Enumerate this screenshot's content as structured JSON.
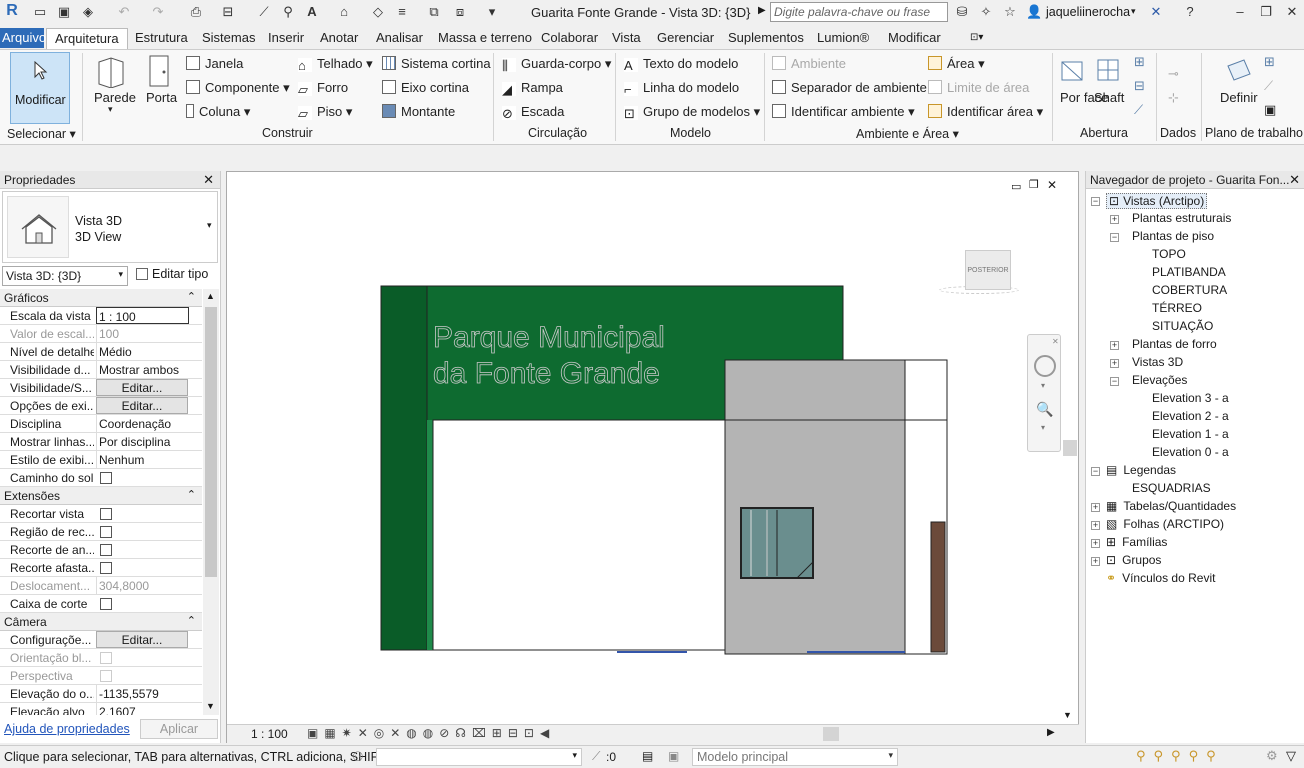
{
  "titlebar": {
    "title": "Guarita Fonte Grande - Vista 3D: {3D}",
    "search_placeholder": "Digite palavra-chave ou frase",
    "user": "jaqueliinerocha"
  },
  "menu": {
    "file": "Arquivo",
    "tabs": [
      "Arquitetura",
      "Estrutura",
      "Sistemas",
      "Inserir",
      "Anotar",
      "Analisar",
      "Massa e terreno",
      "Colaborar",
      "Vista",
      "Gerenciar",
      "Suplementos",
      "Lumion®",
      "Modificar"
    ]
  },
  "ribbon": {
    "select": {
      "modify": "Modificar",
      "panel": "Selecionar"
    },
    "construir": {
      "wall": "Parede",
      "door": "Porta",
      "window": "Janela",
      "component": "Componente",
      "column": "Coluna",
      "roof": "Telhado",
      "ceiling": "Forro",
      "floor": "Piso",
      "curtain_system": "Sistema cortina",
      "curtain_grid": "Eixo cortina",
      "mullion": "Montante",
      "panel": "Construir"
    },
    "circulacao": {
      "railing": "Guarda-corpo",
      "ramp": "Rampa",
      "stair": "Escada",
      "panel": "Circulação"
    },
    "modelo": {
      "model_text": "Texto do modelo",
      "model_line": "Linha do modelo",
      "model_group": "Grupo de modelos",
      "panel": "Modelo"
    },
    "ambiente": {
      "room": "Ambiente",
      "room_sep": "Separador de ambiente",
      "tag_room": "Identificar ambiente",
      "area": "Área",
      "area_boundary": "Limite de área",
      "tag_area": "Identificar área",
      "panel": "Ambiente e Área"
    },
    "abertura": {
      "by_face": "Por face",
      "shaft": "Shaft",
      "panel": "Abertura"
    },
    "dados": {
      "panel": "Dados"
    },
    "plano": {
      "set": "Definir",
      "panel": "Plano de trabalho"
    }
  },
  "properties": {
    "title": "Propriedades",
    "type_name": "Vista 3D",
    "type_sub": "3D View",
    "selector": "Vista 3D: {3D}",
    "edit_type": "Editar tipo",
    "groups": {
      "graphics": "Gráficos",
      "extents": "Extensões",
      "camera": "Câmera"
    },
    "rows": [
      {
        "k": "Escala da vista",
        "v": "1 : 100"
      },
      {
        "k": "Valor de escal...",
        "v": "100"
      },
      {
        "k": "Nível de detalhe",
        "v": "Médio"
      },
      {
        "k": "Visibilidade d...",
        "v": "Mostrar ambos"
      },
      {
        "k": "Visibilidade/S...",
        "v": "Editar..."
      },
      {
        "k": "Opções de exi...",
        "v": "Editar..."
      },
      {
        "k": "Disciplina",
        "v": "Coordenação"
      },
      {
        "k": "Mostrar linhas...",
        "v": "Por disciplina"
      },
      {
        "k": "Estilo de exibi...",
        "v": "Nenhum"
      },
      {
        "k": "Caminho do sol",
        "v": ""
      },
      {
        "k": "Recortar vista",
        "v": ""
      },
      {
        "k": "Região de rec...",
        "v": ""
      },
      {
        "k": "Recorte de an...",
        "v": ""
      },
      {
        "k": "Recorte afasta...",
        "v": ""
      },
      {
        "k": "Deslocament...",
        "v": "304,8000"
      },
      {
        "k": "Caixa de corte",
        "v": ""
      },
      {
        "k": "Configuraçõe...",
        "v": "Editar..."
      },
      {
        "k": "Orientação bl...",
        "v": ""
      },
      {
        "k": "Perspectiva",
        "v": ""
      },
      {
        "k": "Elevação do o...",
        "v": "-1135,5579"
      },
      {
        "k": "Elevação alvo",
        "v": "2,1607"
      }
    ],
    "help_link": "Ajuda de propriedades",
    "apply": "Aplicar"
  },
  "viewport": {
    "sign_line1": "Parque Municipal",
    "sign_line2": "da Fonte Grande",
    "viewcube": "POSTERIOR",
    "scale": "1 : 100"
  },
  "navigator": {
    "title": "Navegador de projeto - Guarita Fon...",
    "items": [
      {
        "label": "Vistas (Arctipo)"
      },
      {
        "label": "Plantas estruturais"
      },
      {
        "label": "Plantas de piso"
      },
      {
        "label": "TOPO"
      },
      {
        "label": "PLATIBANDA"
      },
      {
        "label": "COBERTURA"
      },
      {
        "label": "TÉRREO"
      },
      {
        "label": "SITUAÇÃO"
      },
      {
        "label": "Plantas de forro"
      },
      {
        "label": "Vistas 3D"
      },
      {
        "label": "Elevações"
      },
      {
        "label": "Elevation 3 - a"
      },
      {
        "label": "Elevation 2 - a"
      },
      {
        "label": "Elevation 1 - a"
      },
      {
        "label": "Elevation 0 - a"
      },
      {
        "label": "Legendas"
      },
      {
        "label": "ESQUADRIAS"
      },
      {
        "label": "Tabelas/Quantidades"
      },
      {
        "label": "Folhas (ARCTIPO)"
      },
      {
        "label": "Famílias"
      },
      {
        "label": "Grupos"
      },
      {
        "label": "Vínculos do Revit"
      }
    ]
  },
  "statusbar": {
    "message": "Clique para selecionar, TAB para alternativas, CTRL adiciona, SHIF",
    "count": ":0",
    "model": "Modelo principal"
  },
  "colors": {
    "green": "#0e6b30",
    "accent": "#2d6bb8"
  }
}
